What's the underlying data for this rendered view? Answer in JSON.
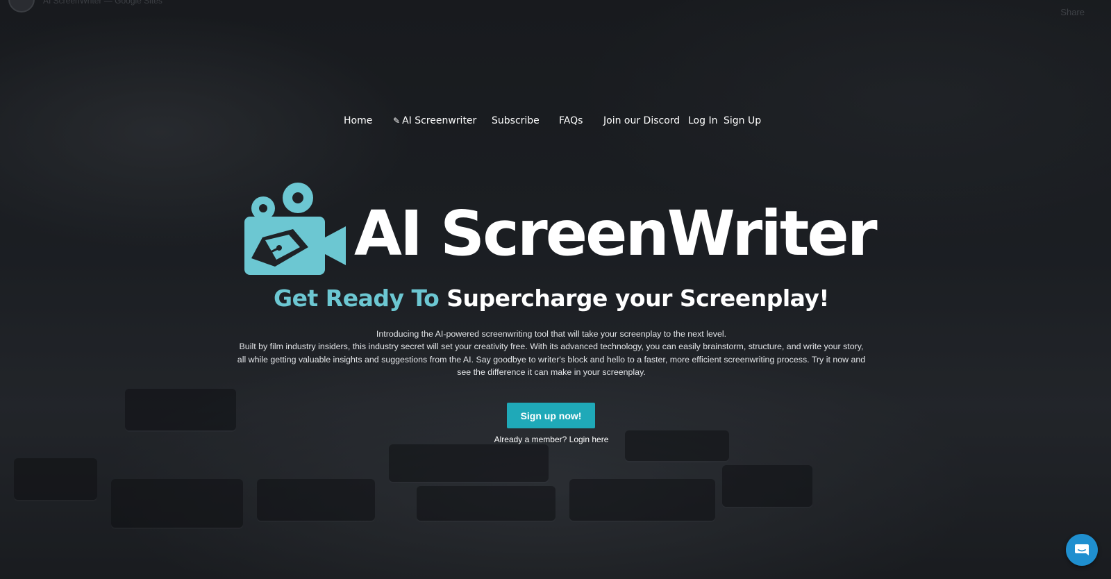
{
  "top_bar": {
    "title": "AI ScreenWriter — Google Sites",
    "share_label": "Share"
  },
  "nav": {
    "items": [
      {
        "label": "Home"
      },
      {
        "icon": "pencil-icon",
        "label": "AI Screenwriter"
      },
      {
        "label": "Subscribe"
      },
      {
        "label": "FAQs"
      },
      {
        "label": "Join our Discord"
      },
      {
        "label": "Log In"
      },
      {
        "label": "Sign Up"
      }
    ]
  },
  "brand": {
    "logo_text": "AI ScreenWriter",
    "logo_icon": "movie-camera-pen-icon",
    "logo_color": "#6cc7d2"
  },
  "hero": {
    "headline_accent": "Get Ready To",
    "headline_rest": "Supercharge your Screenplay!",
    "intro_line1": "Introducing the AI-powered screenwriting tool that will take your screenplay to the next level.",
    "intro_line2": "Built by film industry insiders, this industry secret will set your creativity free. With its advanced technology, you can easily brainstorm, structure, and write your story, all while getting valuable insights and suggestions from the AI. Say goodbye to writer's block and hello to a faster, more efficient screenwriting process. Try it now and see the difference it can make in your screenplay.",
    "cta_label": "Sign up now!",
    "login_prompt": "Already a member? Login here"
  },
  "chat": {
    "icon": "chat-bubble-icon",
    "color": "#1f8fcf"
  },
  "colors": {
    "accent": "#6cc7d2",
    "button": "#1fa9b8"
  }
}
